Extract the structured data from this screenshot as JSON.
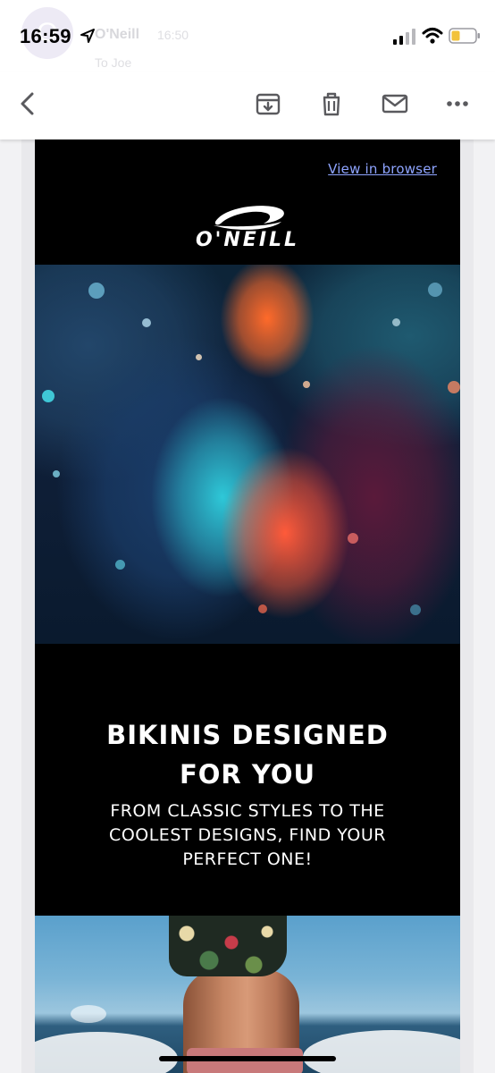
{
  "status_bar": {
    "time": "16:59"
  },
  "email_header": {
    "sender_initial": "O",
    "sender_name": "O'Neill",
    "sent_time": "16:50",
    "recipient": "To Joe"
  },
  "toolbar": {
    "back_icon": "chevron-left-icon",
    "archive_icon": "archive-icon",
    "delete_icon": "trash-icon",
    "mark_unread_icon": "envelope-icon",
    "more_icon": "ellipsis-icon",
    "icon_color": "#5a5a5e"
  },
  "email": {
    "view_in_browser": "View in browser",
    "brand_name": "O'NEILL",
    "headline_line1": "BIKINIS DESIGNED",
    "headline_line2": "FOR YOU",
    "subline_line1": "FROM CLASSIC STYLES TO THE",
    "subline_line2": "COOLEST DESIGNS, FIND YOUR",
    "subline_line3": "PERFECT ONE!",
    "background_color": "#000000",
    "link_color": "#8ea4ff"
  }
}
